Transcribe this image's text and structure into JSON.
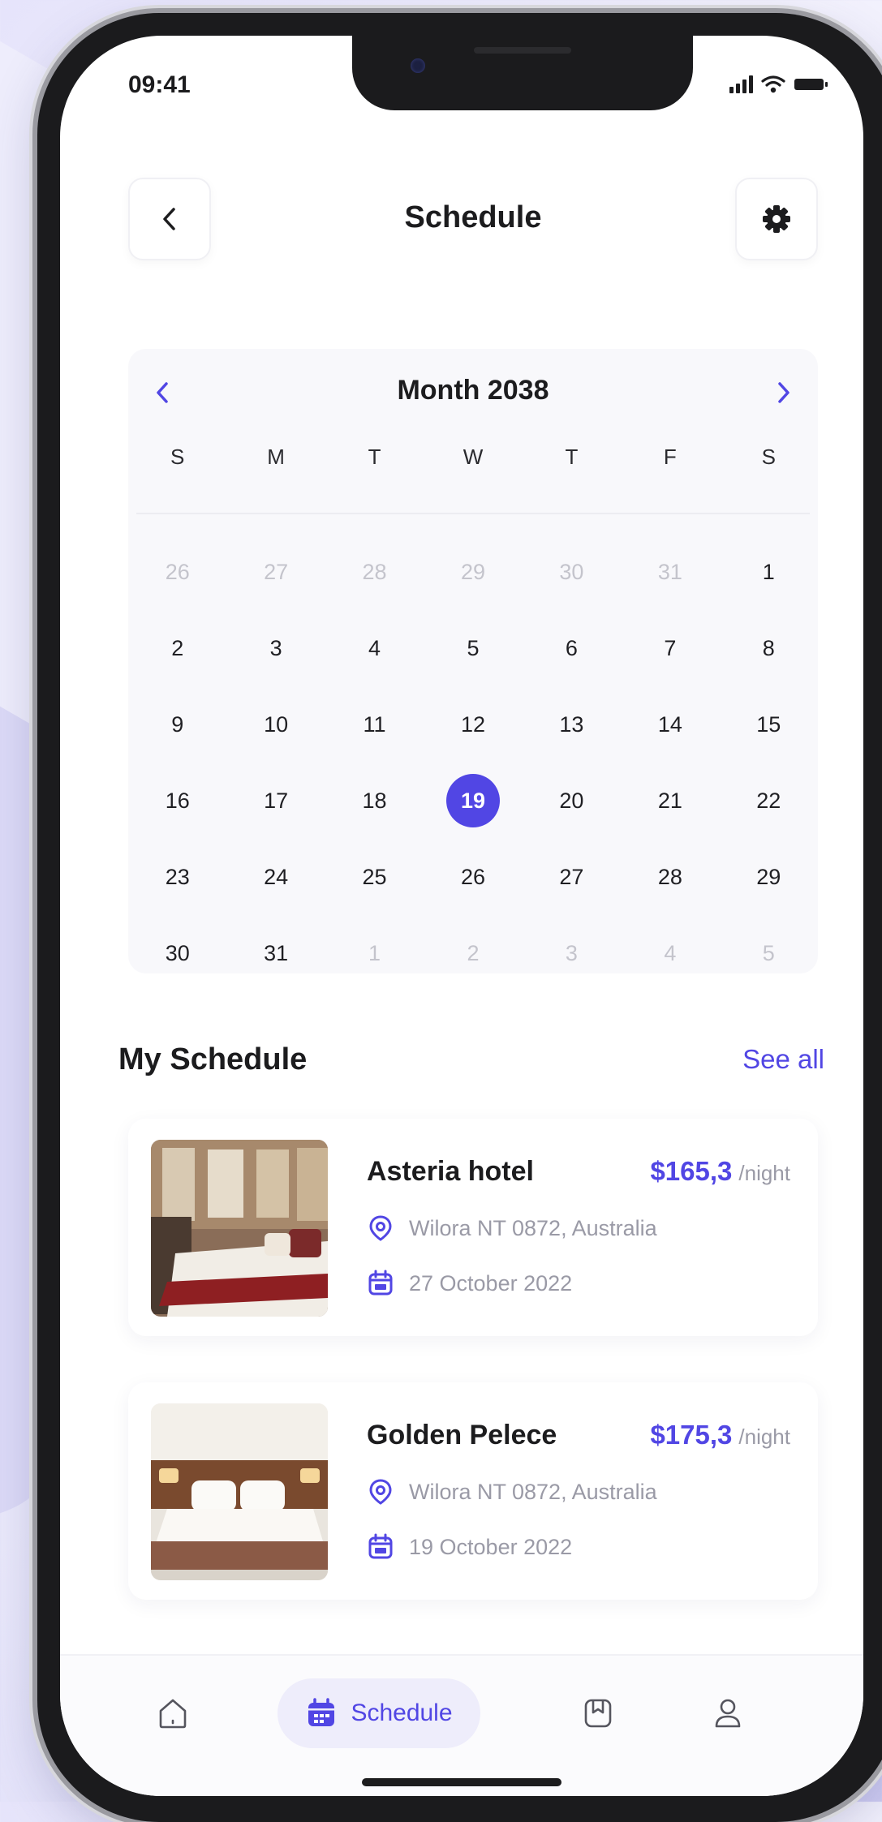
{
  "status_bar": {
    "time": "09:41"
  },
  "header": {
    "title": "Schedule"
  },
  "calendar": {
    "title": "Month 2038",
    "weekdays": [
      "S",
      "M",
      "T",
      "W",
      "T",
      "F",
      "S"
    ],
    "days": [
      {
        "label": "26",
        "muted": true
      },
      {
        "label": "27",
        "muted": true
      },
      {
        "label": "28",
        "muted": true
      },
      {
        "label": "29",
        "muted": true
      },
      {
        "label": "30",
        "muted": true
      },
      {
        "label": "31",
        "muted": true
      },
      {
        "label": "1",
        "muted": false
      },
      {
        "label": "2",
        "muted": false
      },
      {
        "label": "3",
        "muted": false
      },
      {
        "label": "4",
        "muted": false
      },
      {
        "label": "5",
        "muted": false
      },
      {
        "label": "6",
        "muted": false
      },
      {
        "label": "7",
        "muted": false
      },
      {
        "label": "8",
        "muted": false
      },
      {
        "label": "9",
        "muted": false
      },
      {
        "label": "10",
        "muted": false
      },
      {
        "label": "11",
        "muted": false
      },
      {
        "label": "12",
        "muted": false
      },
      {
        "label": "13",
        "muted": false
      },
      {
        "label": "14",
        "muted": false
      },
      {
        "label": "15",
        "muted": false
      },
      {
        "label": "16",
        "muted": false
      },
      {
        "label": "17",
        "muted": false
      },
      {
        "label": "18",
        "muted": false
      },
      {
        "label": "19",
        "muted": false,
        "selected": true
      },
      {
        "label": "20",
        "muted": false
      },
      {
        "label": "21",
        "muted": false
      },
      {
        "label": "22",
        "muted": false
      },
      {
        "label": "23",
        "muted": false
      },
      {
        "label": "24",
        "muted": false
      },
      {
        "label": "25",
        "muted": false
      },
      {
        "label": "26",
        "muted": false
      },
      {
        "label": "27",
        "muted": false
      },
      {
        "label": "28",
        "muted": false
      },
      {
        "label": "29",
        "muted": false
      },
      {
        "label": "30",
        "muted": false
      },
      {
        "label": "31",
        "muted": false
      },
      {
        "label": "1",
        "muted": true
      },
      {
        "label": "2",
        "muted": true
      },
      {
        "label": "3",
        "muted": true
      },
      {
        "label": "4",
        "muted": true
      },
      {
        "label": "5",
        "muted": true
      }
    ]
  },
  "my_schedule": {
    "title": "My Schedule",
    "see_all": "See all",
    "items": [
      {
        "name": "Asteria hotel",
        "price": "$165,3",
        "unit": "/night",
        "location": "Wilora NT 0872, Australia",
        "date": "27 October 2022"
      },
      {
        "name": "Golden Pelece",
        "price": "$175,3",
        "unit": "/night",
        "location": "Wilora NT 0872, Australia",
        "date": "19 October 2022"
      }
    ]
  },
  "tabbar": {
    "active_label": "Schedule"
  },
  "colors": {
    "accent": "#5146e4",
    "text": "#1c1c1e",
    "muted": "#9a9aa6"
  },
  "icons": [
    "back-icon",
    "gear-icon",
    "chevron-left-icon",
    "chevron-right-icon",
    "location-pin-icon",
    "calendar-icon",
    "home-icon",
    "bookmark-icon",
    "profile-icon",
    "signal-icon",
    "wifi-icon",
    "battery-icon"
  ]
}
